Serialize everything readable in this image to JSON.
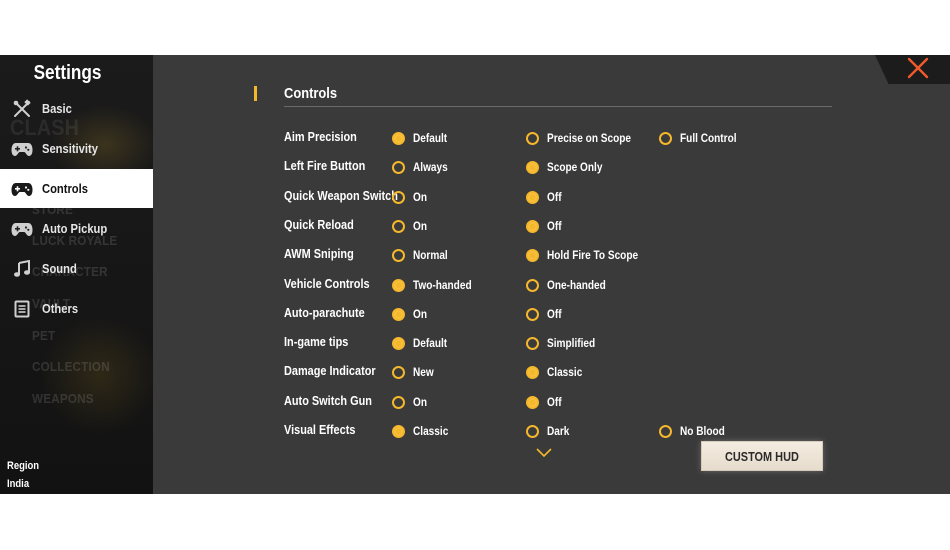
{
  "sidebar": {
    "title": "Settings",
    "items": [
      {
        "label": "Basic",
        "icon": "tools-icon",
        "active": false
      },
      {
        "label": "Sensitivity",
        "icon": "gamepad-icon",
        "active": false
      },
      {
        "label": "Controls",
        "icon": "gamepad-icon",
        "active": true
      },
      {
        "label": "Auto Pickup",
        "icon": "gamepad-icon",
        "active": false
      },
      {
        "label": "Sound",
        "icon": "music-note-icon",
        "active": false
      },
      {
        "label": "Others",
        "icon": "document-icon",
        "active": false
      }
    ],
    "background_words": [
      "CLASH",
      "STORE",
      "LUCK ROYALE",
      "CHARACTER",
      "VAULT",
      "PET",
      "COLLECTION",
      "WEAPONS"
    ],
    "region": {
      "label": "Region",
      "value": "India"
    }
  },
  "main": {
    "section_title": "Controls",
    "settings": [
      {
        "label": "Aim Precision",
        "options": [
          "Default",
          "Precise on Scope",
          "Full Control"
        ],
        "selected": 0
      },
      {
        "label": "Left Fire Button",
        "options": [
          "Always",
          "Scope Only"
        ],
        "selected": 1
      },
      {
        "label": "Quick Weapon Switch",
        "options": [
          "On",
          "Off"
        ],
        "selected": 1
      },
      {
        "label": "Quick Reload",
        "options": [
          "On",
          "Off"
        ],
        "selected": 1
      },
      {
        "label": "AWM Sniping",
        "options": [
          "Normal",
          "Hold Fire To Scope"
        ],
        "selected": 1
      },
      {
        "label": "Vehicle Controls",
        "options": [
          "Two-handed",
          "One-handed"
        ],
        "selected": 0
      },
      {
        "label": "Auto-parachute",
        "options": [
          "On",
          "Off"
        ],
        "selected": 0
      },
      {
        "label": "In-game tips",
        "options": [
          "Default",
          "Simplified"
        ],
        "selected": 0
      },
      {
        "label": "Damage Indicator",
        "options": [
          "New",
          "Classic"
        ],
        "selected": 1
      },
      {
        "label": "Auto Switch Gun",
        "options": [
          "On",
          "Off"
        ],
        "selected": 1
      },
      {
        "label": "Visual Effects",
        "options": [
          "Classic",
          "Dark",
          "No Blood"
        ],
        "selected": 0
      }
    ],
    "custom_hud_label": "CUSTOM HUD"
  },
  "colors": {
    "accent": "#f5b82c",
    "close": "#f0592b",
    "panel": "#3a3a3a",
    "sidebar": "#181818"
  }
}
